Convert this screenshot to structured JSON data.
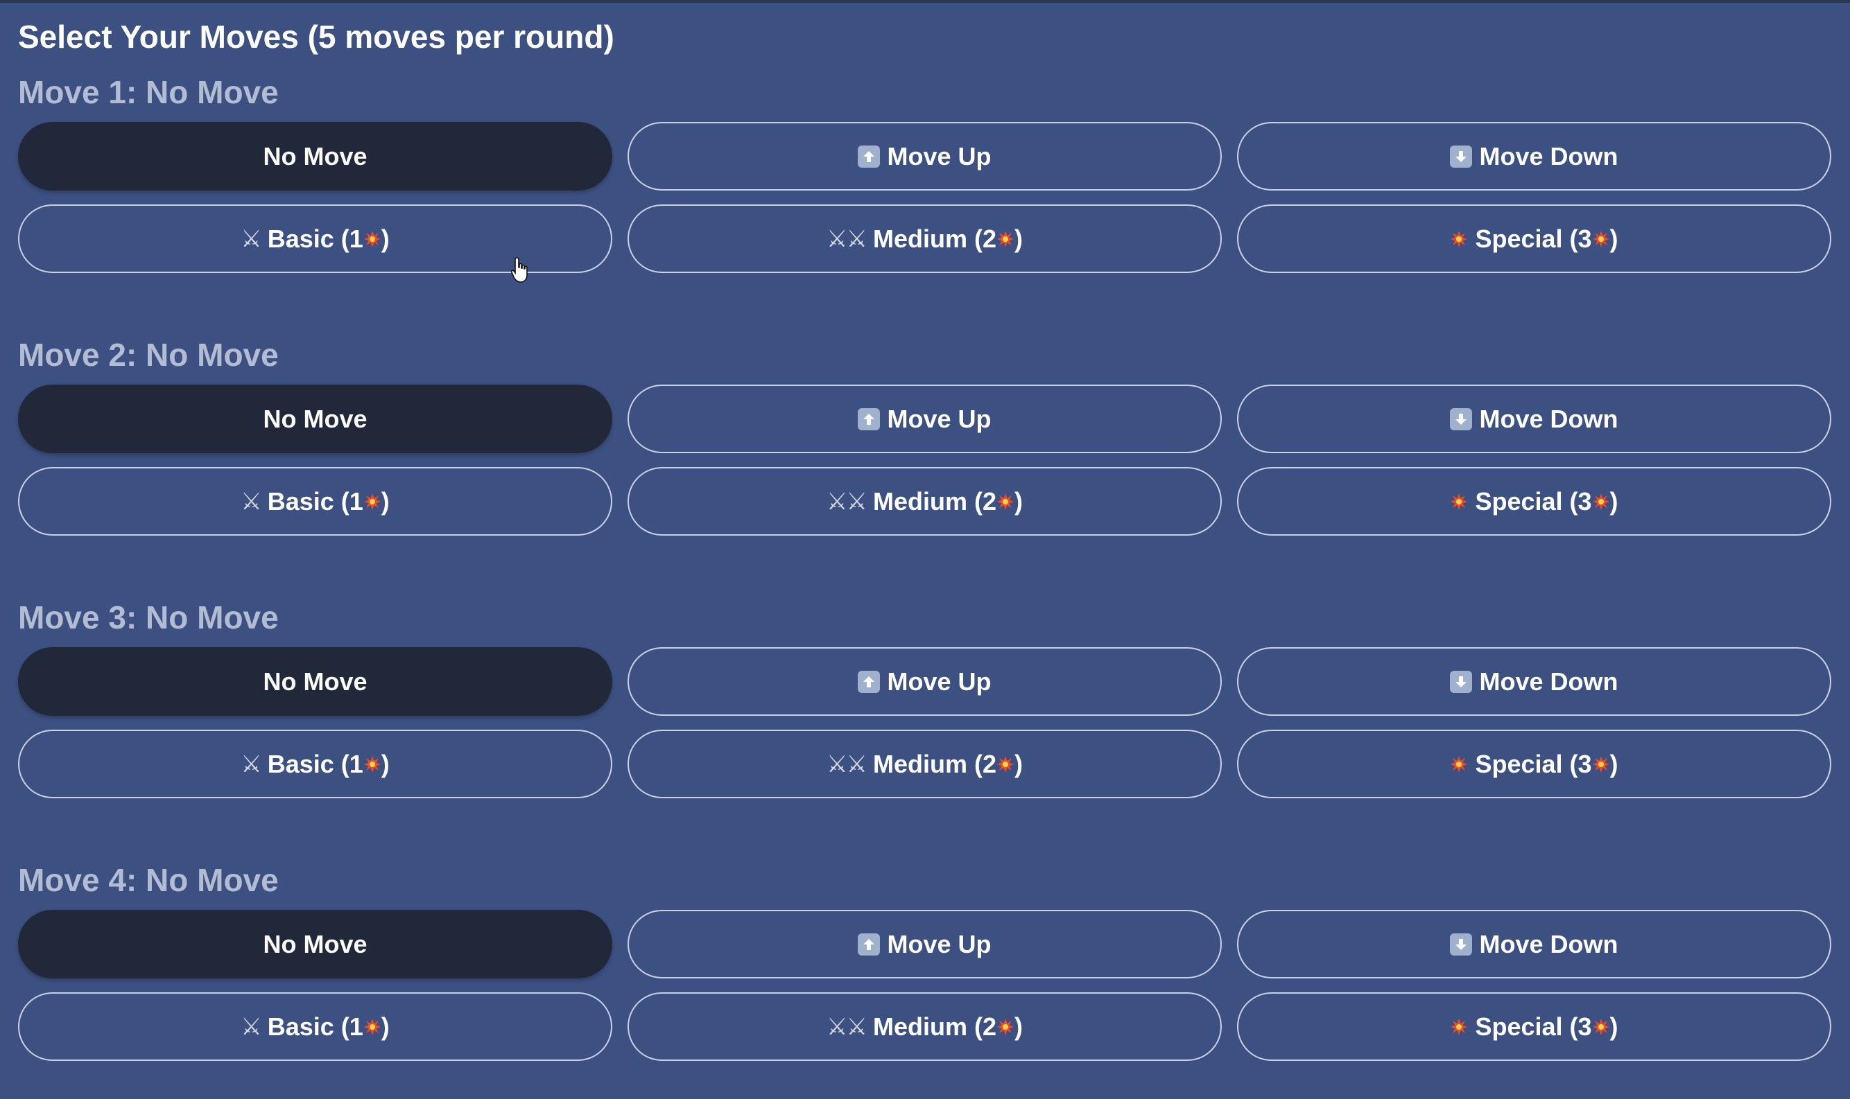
{
  "title": "Select Your Moves (5 moves per round)",
  "move_groups": [
    {
      "heading": "Move 1: No Move",
      "options": [
        {
          "label": "No Move",
          "icon": "",
          "selected": true
        },
        {
          "label": "Move Up",
          "icon": "up-arrow-icon",
          "selected": false
        },
        {
          "label": "Move Down",
          "icon": "down-arrow-icon",
          "selected": false
        },
        {
          "label": "Basic (1",
          "suffix": ")",
          "icon": "sword-icon",
          "selected": false
        },
        {
          "label": "Medium (2",
          "suffix": ")",
          "icon": "double-sword-icon",
          "selected": false
        },
        {
          "label": "Special (3",
          "suffix": ")",
          "icon": "burst-icon",
          "selected": false
        }
      ]
    },
    {
      "heading": "Move 2: No Move",
      "options": [
        {
          "label": "No Move",
          "icon": "",
          "selected": true
        },
        {
          "label": "Move Up",
          "icon": "up-arrow-icon",
          "selected": false
        },
        {
          "label": "Move Down",
          "icon": "down-arrow-icon",
          "selected": false
        },
        {
          "label": "Basic (1",
          "suffix": ")",
          "icon": "sword-icon",
          "selected": false
        },
        {
          "label": "Medium (2",
          "suffix": ")",
          "icon": "double-sword-icon",
          "selected": false
        },
        {
          "label": "Special (3",
          "suffix": ")",
          "icon": "burst-icon",
          "selected": false
        }
      ]
    },
    {
      "heading": "Move 3: No Move",
      "options": [
        {
          "label": "No Move",
          "icon": "",
          "selected": true
        },
        {
          "label": "Move Up",
          "icon": "up-arrow-icon",
          "selected": false
        },
        {
          "label": "Move Down",
          "icon": "down-arrow-icon",
          "selected": false
        },
        {
          "label": "Basic (1",
          "suffix": ")",
          "icon": "sword-icon",
          "selected": false
        },
        {
          "label": "Medium (2",
          "suffix": ")",
          "icon": "double-sword-icon",
          "selected": false
        },
        {
          "label": "Special (3",
          "suffix": ")",
          "icon": "burst-icon",
          "selected": false
        }
      ]
    },
    {
      "heading": "Move 4: No Move",
      "options": [
        {
          "label": "No Move",
          "icon": "",
          "selected": true
        },
        {
          "label": "Move Up",
          "icon": "up-arrow-icon",
          "selected": false
        },
        {
          "label": "Move Down",
          "icon": "down-arrow-icon",
          "selected": false
        },
        {
          "label": "Basic (1",
          "suffix": ")",
          "icon": "sword-icon",
          "selected": false
        },
        {
          "label": "Medium (2",
          "suffix": ")",
          "icon": "double-sword-icon",
          "selected": false
        },
        {
          "label": "Special (3",
          "suffix": ")",
          "icon": "burst-icon",
          "selected": false
        }
      ]
    }
  ],
  "colors": {
    "background": "#3c5182",
    "selected_button": "#212839",
    "button_border": "#c9d2e4",
    "heading_text": "#b2bdd3",
    "burst": "#f04a28"
  }
}
